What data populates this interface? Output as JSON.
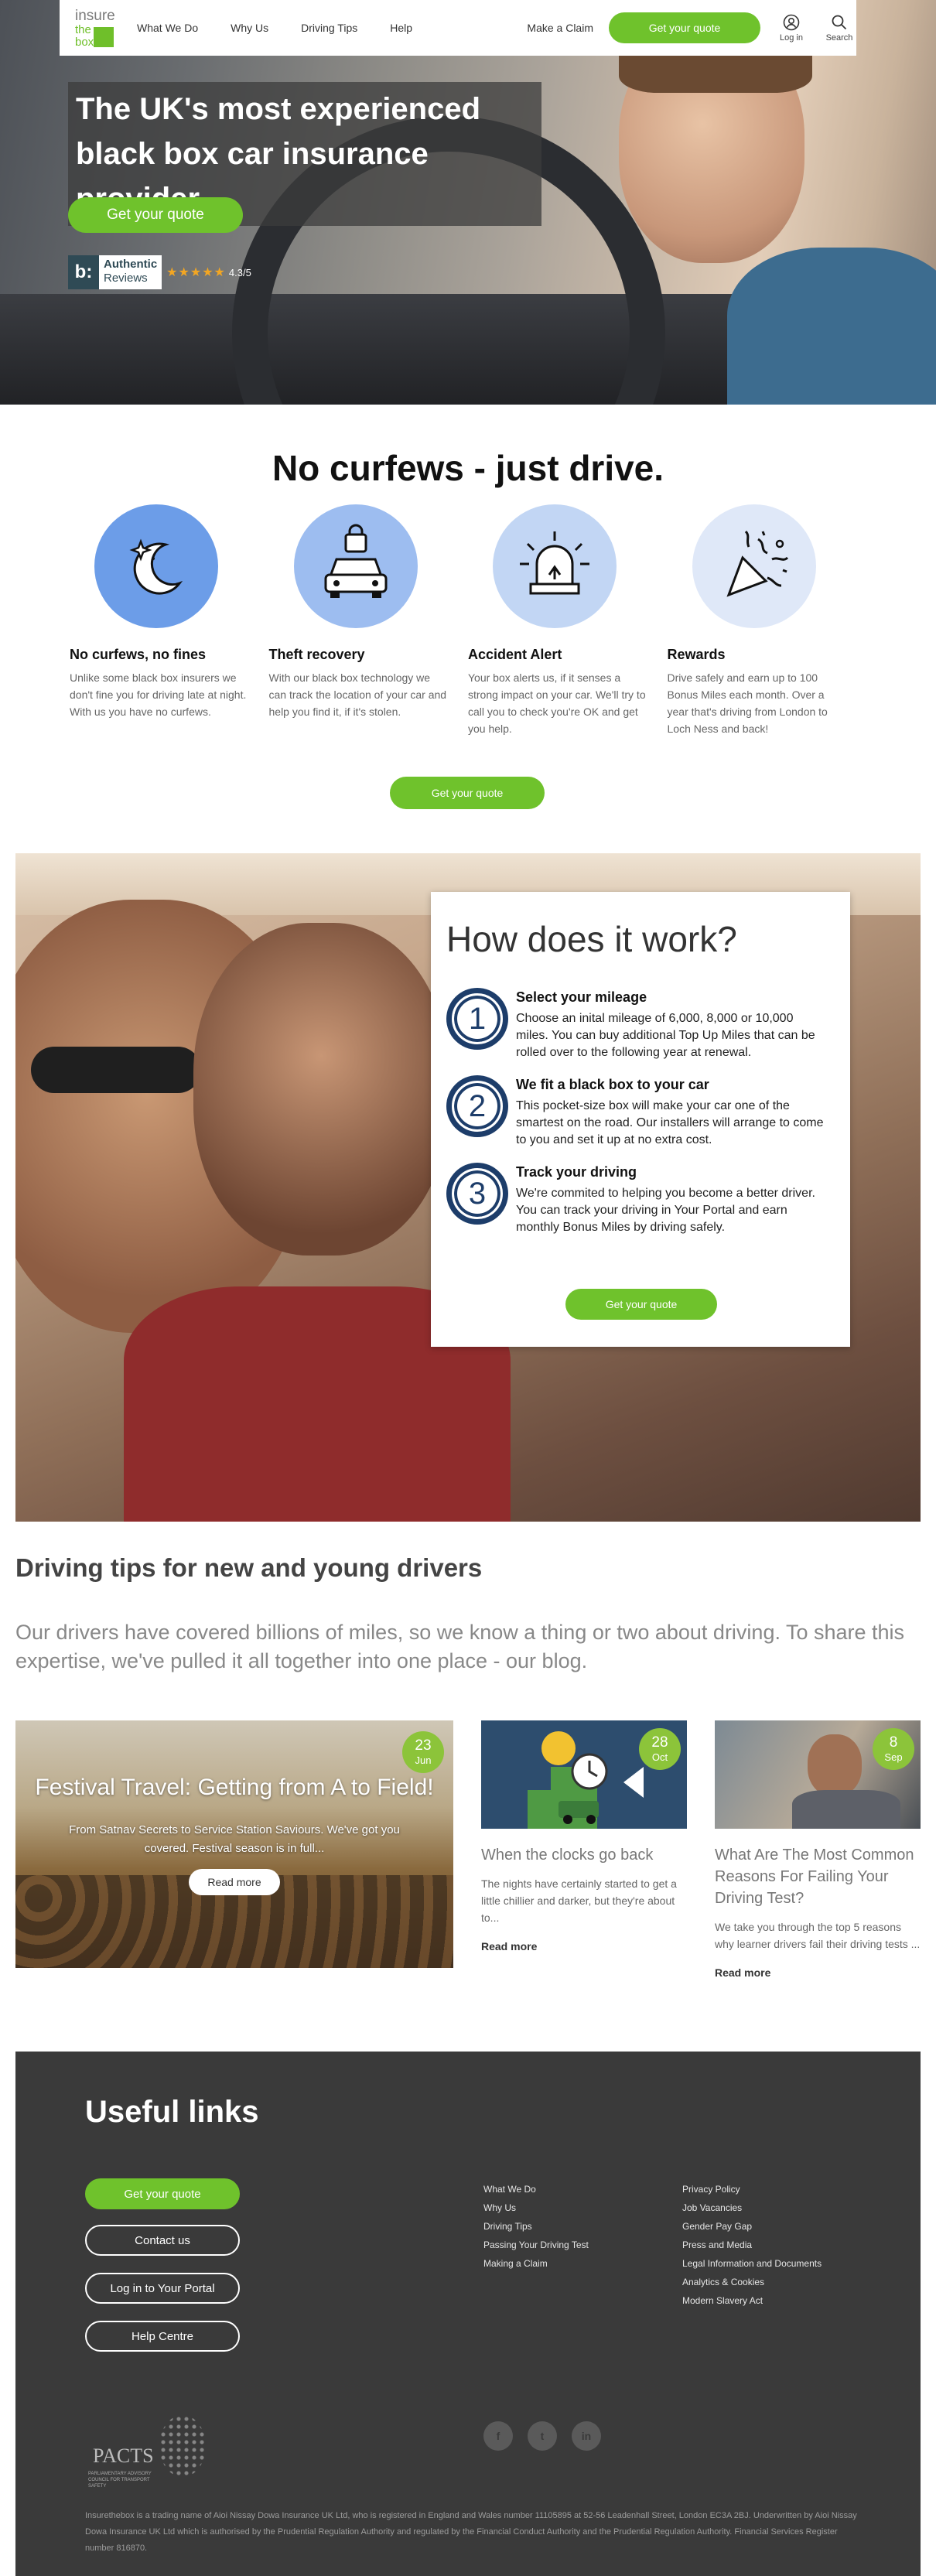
{
  "header": {
    "logo": {
      "line1": "insure",
      "line2": "the",
      "line3": "box"
    },
    "nav": [
      "What We Do",
      "Why Us",
      "Driving Tips",
      "Help"
    ],
    "make_claim": "Make a Claim",
    "cta": "Get your quote",
    "login": "Log in",
    "search": "Search"
  },
  "hero": {
    "title_line1": "The UK's most experienced",
    "title_line2": "black box car insurance provider",
    "cta": "Get your quote",
    "reviews": {
      "badge": "b:",
      "line1": "Authentic",
      "line2": "Reviews",
      "stars": "★★★★★",
      "rating": "4.3/5"
    }
  },
  "features": {
    "title": "No curfews - just drive.",
    "items": [
      {
        "title": "No curfews, no fines",
        "text": "Unlike some black box insurers we don't fine you for driving late at night. With us you have no curfews.",
        "icon": "moon-stars-icon"
      },
      {
        "title": "Theft recovery",
        "text": "With our black box technology we can track the location of your car and help you find it, if it's stolen.",
        "icon": "car-lock-icon"
      },
      {
        "title": "Accident Alert",
        "text": "Your box alerts us, if it senses a strong impact on your car. We'll try to call you to check you're OK and get you help.",
        "icon": "siren-icon"
      },
      {
        "title": "Rewards",
        "text": "Drive safely and earn up to 100 Bonus Miles each month. Over a year that's driving from London to Loch Ness and back!",
        "icon": "party-popper-icon"
      }
    ],
    "cta": "Get your quote"
  },
  "how": {
    "title": "How does it work?",
    "steps": [
      {
        "num": "1",
        "title": "Select your mileage",
        "text": "Choose an inital mileage of 6,000, 8,000 or 10,000 miles. You can buy additional Top Up Miles that can be rolled over to the following year at renewal."
      },
      {
        "num": "2",
        "title": "We fit a black box to your car",
        "text": "This pocket-size box will make your car one of the smartest on the road. Our installers will arrange to come to you and set it up at no extra cost."
      },
      {
        "num": "3",
        "title": "Track your driving",
        "text": "We're commited to helping you become a better driver. You can track your driving in Your Portal and earn monthly Bonus Miles by driving safely."
      }
    ],
    "cta": "Get your quote"
  },
  "blog": {
    "title": "Driving tips for new and young drivers",
    "intro": "Our drivers have covered billions of miles, so we know a thing or two about driving. To share this expertise, we've pulled it all together into one place - our blog.",
    "featured": {
      "title": "Festival Travel: Getting from A to Field!",
      "summary": "From Satnav Secrets to Service Station Saviours. We've got you covered. Festival season is in full...",
      "button": "Read more",
      "day": "23",
      "month": "Jun"
    },
    "posts": [
      {
        "title": "When the clocks go back",
        "text": "The nights have certainly started to get a little chillier and darker, but they're about to...",
        "more": "Read more",
        "day": "28",
        "month": "Oct"
      },
      {
        "title": "What Are The Most Common Reasons For Failing Your Driving Test?",
        "text": "We take you through the top 5 reasons why learner drivers fail their driving tests ...",
        "more": "Read more",
        "day": "8",
        "month": "Sep"
      }
    ]
  },
  "footer": {
    "title": "Useful links",
    "buttons": [
      "Get your quote",
      "Contact us",
      "Log in to Your Portal",
      "Help Centre"
    ],
    "col1": [
      "What We Do",
      "Why Us",
      "Driving Tips",
      "Passing Your Driving Test",
      "Making a Claim"
    ],
    "col2": [
      "Privacy Policy",
      "Job Vacancies",
      "Gender Pay Gap",
      "Press and Media",
      "Legal Information and Documents",
      "Analytics & Cookies",
      "Modern Slavery Act"
    ],
    "socials": [
      "f",
      "t",
      "in"
    ],
    "pacts": {
      "name": "PACTS",
      "sub": "PARLIAMENTARY ADVISORY COUNCIL FOR TRANSPORT SAFETY"
    },
    "legal": "Insurethebox is a trading name of Aioi Nissay Dowa Insurance UK Ltd, who is registered in England and Wales number 11105895 at 52-56 Leadenhall Street, London EC3A 2BJ. Underwritten by Aioi Nissay Dowa Insurance UK Ltd which is authorised by the Prudential Regulation Authority and regulated by the Financial Conduct Authority and the Prudential Regulation Authority. Financial Services Register number 816870."
  }
}
